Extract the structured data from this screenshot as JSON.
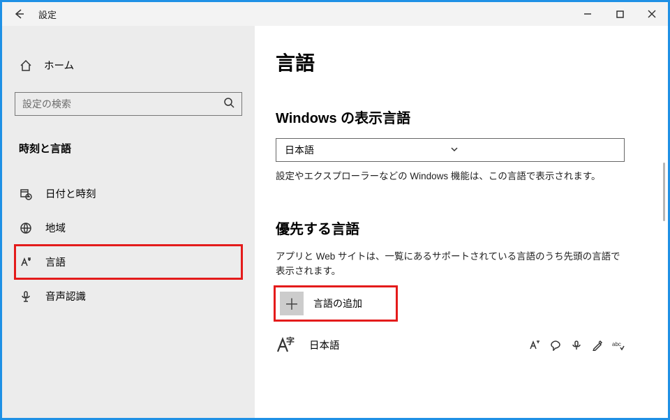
{
  "titlebar": {
    "title": "設定"
  },
  "sidebar": {
    "home": "ホーム",
    "search_placeholder": "設定の検索",
    "category": "時刻と言語",
    "items": [
      {
        "label": "日付と時刻"
      },
      {
        "label": "地域"
      },
      {
        "label": "言語"
      },
      {
        "label": "音声認識"
      }
    ]
  },
  "main": {
    "page_title": "言語",
    "display_lang_section": "Windows の表示言語",
    "display_lang_value": "日本語",
    "display_lang_help": "設定やエクスプローラーなどの Windows 機能は、この言語で表示されます。",
    "preferred_section": "優先する言語",
    "preferred_help": "アプリと Web サイトは、一覧にあるサポートされている言語のうち先頭の言語で表示されます。",
    "add_language": "言語の追加",
    "installed_language": "日本語"
  }
}
